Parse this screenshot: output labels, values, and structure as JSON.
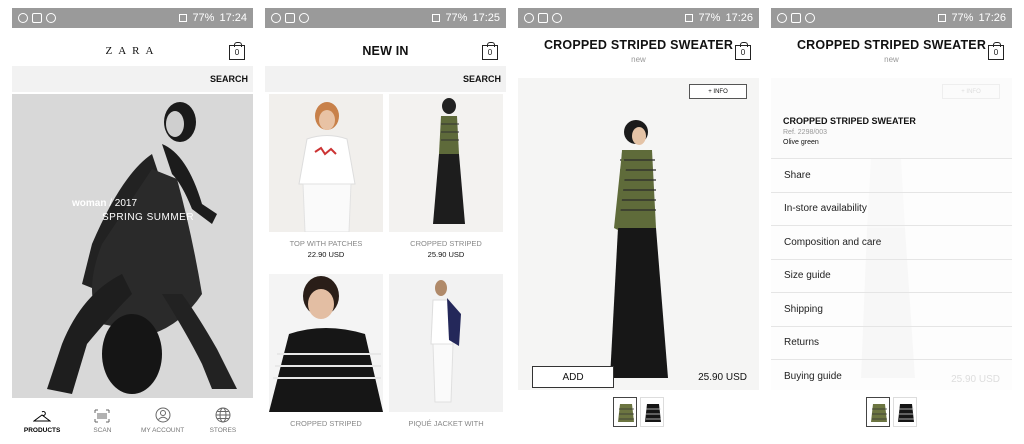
{
  "screens": [
    {
      "status": {
        "battery": "77%",
        "time": "17:24"
      },
      "header": {
        "logo": "ZARA",
        "bag_count": "0"
      },
      "search_label": "SEARCH",
      "hero": {
        "line1_bold": "woman",
        "line1_rest": " / 2017",
        "line2": "SPRING  SUMMER"
      },
      "tabs": [
        {
          "label": "PRODUCTS",
          "icon": "hanger-icon"
        },
        {
          "label": "SCAN",
          "icon": "barcode-icon"
        },
        {
          "label": "MY ACCOUNT",
          "icon": "account-icon"
        },
        {
          "label": "STORES",
          "icon": "globe-icon"
        }
      ]
    },
    {
      "status": {
        "battery": "77%",
        "time": "17:25"
      },
      "header": {
        "title": "NEW IN",
        "bag_count": "0"
      },
      "search_label": "SEARCH",
      "products": [
        {
          "name": "TOP WITH PATCHES",
          "price": "22.90 USD"
        },
        {
          "name": "CROPPED STRIPED",
          "price": "25.90 USD"
        },
        {
          "name": "CROPPED STRIPED",
          "price": ""
        },
        {
          "name": "PIQUÉ JACKET WITH",
          "price": ""
        }
      ]
    },
    {
      "status": {
        "battery": "77%",
        "time": "17:26"
      },
      "header": {
        "title": "CROPPED STRIPED SWEATER",
        "subtitle": "new",
        "bag_count": "0"
      },
      "info_label": "+ INFO",
      "add_label": "ADD",
      "price": "25.90 USD"
    },
    {
      "status": {
        "battery": "77%",
        "time": "17:26"
      },
      "header": {
        "title": "CROPPED STRIPED SWEATER",
        "subtitle": "new",
        "bag_count": "0"
      },
      "info_label": "+ INFO",
      "product": {
        "title": "CROPPED STRIPED SWEATER",
        "ref": "Ref. 2298/003",
        "color": "Olive green"
      },
      "menu": [
        "Share",
        "In-store availability",
        "Composition and care",
        "Size guide",
        "Shipping",
        "Returns",
        "Buying guide"
      ],
      "faint_price": "25.90 USD"
    }
  ]
}
